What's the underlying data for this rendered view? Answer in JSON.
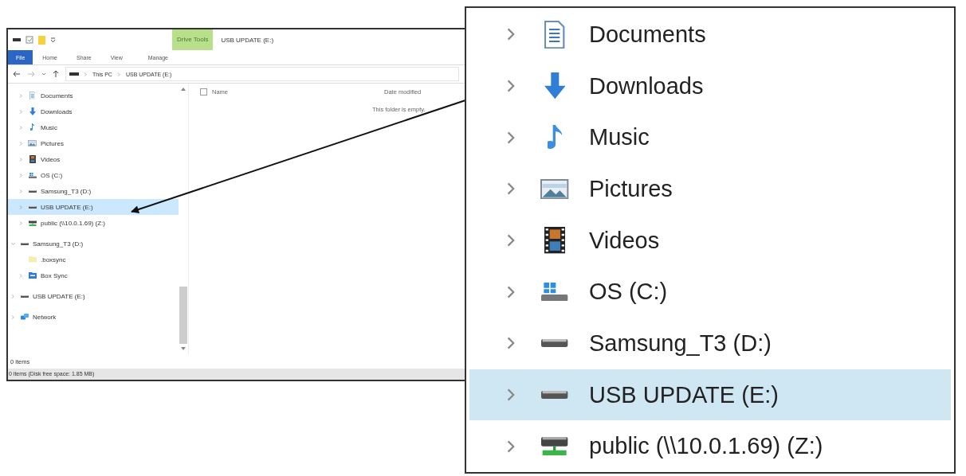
{
  "window": {
    "context_label": "Drive Tools",
    "title": "USB UPDATE (E:)",
    "tabs": [
      {
        "label": "File",
        "kind": "file"
      },
      {
        "label": "Home",
        "kind": "tab"
      },
      {
        "label": "Share",
        "kind": "tab"
      },
      {
        "label": "View",
        "kind": "tab"
      },
      {
        "label": "Manage",
        "kind": "context"
      }
    ],
    "breadcrumb": [
      "This PC",
      "USB UPDATE (E:)"
    ],
    "nav_tree": {
      "this_pc_children": [
        {
          "label": "Documents",
          "kind": "documents",
          "expanded": false,
          "selected": false
        },
        {
          "label": "Downloads",
          "kind": "downloads",
          "expanded": false,
          "selected": false
        },
        {
          "label": "Music",
          "kind": "music",
          "expanded": false,
          "selected": false
        },
        {
          "label": "Pictures",
          "kind": "pictures",
          "expanded": false,
          "selected": false
        },
        {
          "label": "Videos",
          "kind": "videos",
          "expanded": false,
          "selected": false
        },
        {
          "label": "OS (C:)",
          "kind": "os",
          "expanded": false,
          "selected": false
        },
        {
          "label": "Samsung_T3 (D:)",
          "kind": "drive",
          "expanded": false,
          "selected": false
        },
        {
          "label": "USB UPDATE (E:)",
          "kind": "drive",
          "expanded": false,
          "selected": true
        },
        {
          "label": "public (\\\\10.0.1.69) (Z:)",
          "kind": "netdrive",
          "expanded": false,
          "selected": false
        }
      ],
      "roots": [
        {
          "label": "Samsung_T3 (D:)",
          "kind": "drive",
          "expanded": true,
          "selected": false,
          "children": [
            {
              "label": ".boxsync",
              "kind": "folder",
              "selected": false
            },
            {
              "label": "Box Sync",
              "kind": "box",
              "expanded": false,
              "selected": false
            }
          ]
        },
        {
          "label": "USB UPDATE (E:)",
          "kind": "drive",
          "expanded": false,
          "selected": false
        },
        {
          "label": "Network",
          "kind": "network",
          "expanded": false,
          "selected": false
        }
      ]
    },
    "select_all": {
      "checked": false
    },
    "columns": [
      "Name",
      "Date modified"
    ],
    "empty_message": "This folder is empty.",
    "item_count": "0 items",
    "status_bar": "0 items (Disk free space: 1.85 MB)"
  },
  "callout": [
    {
      "label": "Documents",
      "kind": "documents",
      "selected": false
    },
    {
      "label": "Downloads",
      "kind": "downloads",
      "selected": false
    },
    {
      "label": "Music",
      "kind": "music",
      "selected": false
    },
    {
      "label": "Pictures",
      "kind": "pictures",
      "selected": false
    },
    {
      "label": "Videos",
      "kind": "videos",
      "selected": false
    },
    {
      "label": "OS (C:)",
      "kind": "os",
      "selected": false
    },
    {
      "label": "Samsung_T3 (D:)",
      "kind": "drive",
      "selected": false
    },
    {
      "label": "USB UPDATE (E:)",
      "kind": "drive",
      "selected": true
    },
    {
      "label": "public (\\\\10.0.1.69) (Z:)",
      "kind": "netdrive",
      "selected": false
    }
  ]
}
